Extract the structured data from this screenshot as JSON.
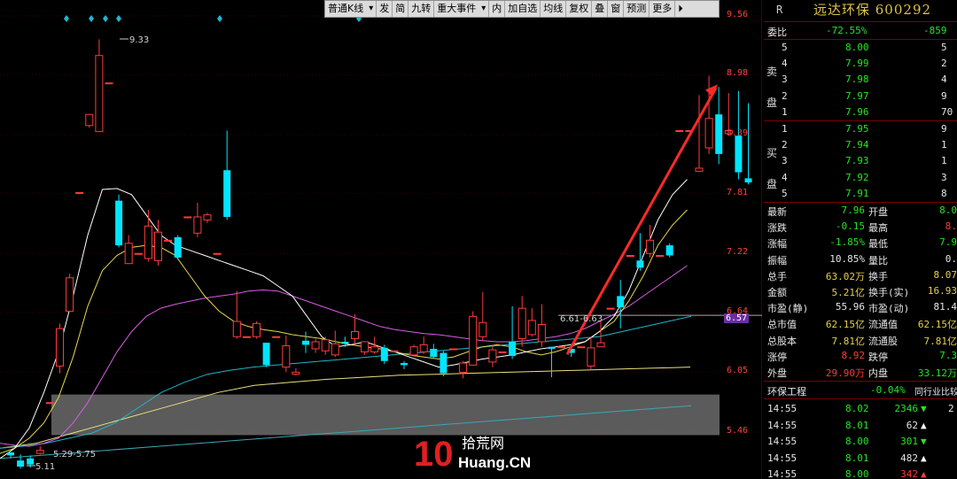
{
  "toolbar": [
    {
      "label": "普通K线",
      "dropdown": true
    },
    {
      "label": "发"
    },
    {
      "label": "简"
    },
    {
      "label": "九转"
    },
    {
      "label": "重大事件",
      "dropdown": true
    },
    {
      "label": "内"
    },
    {
      "label": "加自选"
    },
    {
      "label": "均线"
    },
    {
      "label": "复权"
    },
    {
      "label": "叠"
    },
    {
      "label": "窗"
    },
    {
      "label": "预测"
    },
    {
      "label": "更多"
    },
    {
      "label": "⏵"
    }
  ],
  "stock": {
    "r": "R",
    "name": "远达环保 600292"
  },
  "colors": {
    "up": "#ff3b3b",
    "down": "#00e5ff",
    "ma5": "#ffffff",
    "ma10": "#e6d84a",
    "ma20": "#d95ce6",
    "ma60": "#1fb6c9",
    "ma120": "#e8e080",
    "ma250": "#3aa7b8",
    "box": "#d8d8d8",
    "trend": "#ff2a2a"
  },
  "chart_data": {
    "type": "candlestick",
    "y_ticks": [
      "9.56",
      "8.98",
      "8.39",
      "7.81",
      "7.22",
      "6.64",
      "6.05",
      "5.46"
    ],
    "current_price_label": "6.57",
    "annotations": {
      "high": "9.33",
      "low": "5.11",
      "range": "5.29-5.75",
      "line": "6.61-6.63"
    },
    "event_markers": 4,
    "candles": [
      [
        5.26,
        5.23,
        5.26,
        5.2
      ],
      [
        5.18,
        5.12,
        5.24,
        5.1
      ],
      [
        5.2,
        5.14,
        5.23,
        5.11
      ],
      [
        5.25,
        5.28,
        5.32,
        5.24
      ],
      [
        5.75,
        5.75,
        5.75,
        5.75
      ],
      [
        6.11,
        6.48,
        6.53,
        6.04
      ],
      [
        6.65,
        6.98,
        7.02,
        6.66
      ],
      [
        7.82,
        7.82,
        7.82,
        7.82
      ],
      [
        8.48,
        8.59,
        8.57,
        8.46
      ],
      [
        8.42,
        9.17,
        9.33,
        8.42
      ],
      [
        8.9,
        8.9,
        8.9,
        8.9
      ],
      [
        7.74,
        7.3,
        7.8,
        7.28
      ],
      [
        7.12,
        7.32,
        7.4,
        7.12
      ],
      [
        7.22,
        7.22,
        7.22,
        7.22
      ],
      [
        7.17,
        7.49,
        7.65,
        7.14
      ],
      [
        7.15,
        7.43,
        7.55,
        7.1
      ],
      [
        7.35,
        7.35,
        7.35,
        7.35
      ],
      [
        7.38,
        7.18,
        7.4,
        7.16
      ],
      [
        7.58,
        7.58,
        7.58,
        7.58
      ],
      [
        7.42,
        7.58,
        7.72,
        7.38
      ],
      [
        7.55,
        7.6,
        7.62,
        7.52
      ],
      [
        7.22,
        7.22,
        7.22,
        7.22
      ],
      [
        8.04,
        7.58,
        8.43,
        7.55
      ],
      [
        6.4,
        6.55,
        6.85,
        6.38
      ],
      [
        6.4,
        6.4,
        6.4,
        6.4
      ],
      [
        6.4,
        6.53,
        6.55,
        6.38
      ],
      [
        6.34,
        6.12,
        6.34,
        6.1
      ],
      [
        6.4,
        6.4,
        6.4,
        6.4
      ],
      [
        6.1,
        6.31,
        6.41,
        6.05
      ],
      [
        6.03,
        6.05,
        6.09,
        6.02
      ],
      [
        6.36,
        6.32,
        6.45,
        6.24
      ],
      [
        6.28,
        6.35,
        6.38,
        6.24
      ],
      [
        6.26,
        6.37,
        6.4,
        6.22
      ],
      [
        6.22,
        6.33,
        6.46,
        6.2
      ],
      [
        6.35,
        6.33,
        6.4,
        6.3
      ],
      [
        6.38,
        6.45,
        6.62,
        6.32
      ],
      [
        6.25,
        6.35,
        6.35,
        6.22
      ],
      [
        6.25,
        6.3,
        6.4,
        6.23
      ],
      [
        6.29,
        6.16,
        6.32,
        6.13
      ],
      [
        6.26,
        6.26,
        6.26,
        6.26
      ],
      [
        6.14,
        6.12,
        6.16,
        6.08
      ],
      [
        6.22,
        6.3,
        6.32,
        6.2
      ],
      [
        6.25,
        6.32,
        6.4,
        6.23
      ],
      [
        6.28,
        6.2,
        6.33,
        6.18
      ],
      [
        6.24,
        6.04,
        6.26,
        6.01
      ],
      [
        6.28,
        6.28,
        6.28,
        6.28
      ],
      [
        6.05,
        6.14,
        6.16,
        5.99
      ],
      [
        6.12,
        6.6,
        6.65,
        6.12
      ],
      [
        6.4,
        6.54,
        6.84,
        6.36
      ],
      [
        6.15,
        6.27,
        6.32,
        6.1
      ],
      [
        6.25,
        6.25,
        6.25,
        6.25
      ],
      [
        6.35,
        6.21,
        6.7,
        6.18
      ],
      [
        6.38,
        6.68,
        6.8,
        6.3
      ],
      [
        6.42,
        6.56,
        6.68,
        6.4
      ],
      [
        6.35,
        6.52,
        6.72,
        6.3
      ],
      [
        6.3,
        6.28,
        6.3,
        6.0
      ],
      [
        6.3,
        6.3,
        6.3,
        6.3
      ],
      [
        6.28,
        6.24,
        6.32,
        6.2
      ],
      [
        6.3,
        6.3,
        6.3,
        6.3
      ],
      [
        6.11,
        6.29,
        6.4,
        6.08
      ],
      [
        6.3,
        6.34,
        6.55,
        6.3
      ],
      [
        6.68,
        6.68,
        6.68,
        6.68
      ],
      [
        6.8,
        6.69,
        6.96,
        6.48
      ],
      [
        7.2,
        7.2,
        7.2,
        7.2
      ],
      [
        7.15,
        7.08,
        7.42,
        7.05
      ],
      [
        7.22,
        7.35,
        7.5,
        7.18
      ],
      [
        7.2,
        7.2,
        7.2,
        7.2
      ],
      [
        7.3,
        7.2,
        7.32,
        7.18
      ],
      [
        8.43,
        8.43,
        8.43,
        8.43
      ],
      [
        8.43,
        8.43,
        8.43,
        8.43
      ],
      [
        8.03,
        8.06,
        8.78,
        8.03
      ],
      [
        8.26,
        8.55,
        8.97,
        8.2
      ],
      [
        8.59,
        8.2,
        8.86,
        8.1
      ],
      [
        8.4,
        8.43,
        8.8,
        8.38
      ],
      [
        8.38,
        8.02,
        8.82,
        7.95
      ],
      [
        7.96,
        7.92,
        8.7,
        7.9
      ]
    ],
    "ma_lines": {
      "ma5": [
        5.2,
        5.3,
        5.5,
        5.85,
        6.25,
        6.8,
        7.4,
        7.85,
        7.86,
        7.8,
        7.6,
        7.4,
        7.3,
        7.25,
        7.2,
        7.15,
        7.1,
        7.05,
        7.0,
        6.9,
        6.8,
        6.6,
        6.4,
        6.3,
        6.32,
        6.35,
        6.3,
        6.25,
        6.2,
        6.15,
        6.1,
        6.12,
        6.15,
        6.18,
        6.2,
        6.22,
        6.25,
        6.28,
        6.3,
        6.32,
        6.35,
        6.45,
        6.6,
        6.85,
        7.2,
        7.55,
        7.8,
        7.95
      ],
      "ma10": [
        5.25,
        5.3,
        5.4,
        5.55,
        5.8,
        6.2,
        6.7,
        7.05,
        7.2,
        7.28,
        7.3,
        7.28,
        7.2,
        7.0,
        6.8,
        6.65,
        6.55,
        6.5,
        6.47,
        6.45,
        6.42,
        6.4,
        6.38,
        6.35,
        6.32,
        6.3,
        6.28,
        6.25,
        6.22,
        6.2,
        6.18,
        6.2,
        6.25,
        6.3,
        6.32,
        6.3,
        6.25,
        6.22,
        6.25,
        6.3,
        6.35,
        6.45,
        6.55,
        6.75,
        7.0,
        7.3,
        7.5,
        7.65
      ],
      "ma20": [
        5.35,
        5.33,
        5.32,
        5.35,
        5.4,
        5.55,
        5.75,
        6.0,
        6.25,
        6.45,
        6.6,
        6.68,
        6.72,
        6.75,
        6.78,
        6.8,
        6.82,
        6.85,
        6.86,
        6.85,
        6.8,
        6.75,
        6.7,
        6.65,
        6.6,
        6.55,
        6.5,
        6.47,
        6.45,
        6.43,
        6.42,
        6.4,
        6.38,
        6.36,
        6.35,
        6.35,
        6.36,
        6.38,
        6.4,
        6.43,
        6.48,
        6.55,
        6.62,
        6.7,
        6.8,
        6.9,
        7.0,
        7.1
      ],
      "ma60": [
        5.3,
        5.32,
        5.35,
        5.4,
        5.45,
        5.55,
        5.7,
        5.85,
        5.95,
        6.03,
        6.07,
        6.1,
        6.12,
        6.14,
        6.16,
        6.18,
        6.2,
        6.22,
        6.24,
        6.26,
        6.28,
        6.3,
        6.32,
        6.34,
        6.36,
        6.38,
        6.4,
        6.45,
        6.5,
        6.55,
        6.6
      ],
      "ma120": [
        5.3,
        5.35,
        5.45,
        5.55,
        5.65,
        5.75,
        5.85,
        5.92,
        5.95,
        5.98,
        6.0,
        6.02,
        6.03,
        6.04,
        6.05,
        6.06,
        6.07,
        6.08,
        6.09,
        6.1
      ],
      "ma250": [
        5.2,
        5.24,
        5.28,
        5.32,
        5.36,
        5.4,
        5.44,
        5.48,
        5.52,
        5.56,
        5.6,
        5.64,
        5.68,
        5.72
      ]
    },
    "grey_box": [
      5.43,
      5.83
    ],
    "hline": 6.61,
    "trend": {
      "from": [
        6.7,
        6.4
      ],
      "to": [
        8.92,
        8.55
      ]
    }
  },
  "orderbook": {
    "wb_label": "委比",
    "wb_pct": "-72.55%",
    "wb_val": "-859",
    "sell_label": "卖盘",
    "buy_label": "买盘",
    "sell": [
      {
        "lvl": "5",
        "price": "8.00",
        "vol": "5"
      },
      {
        "lvl": "4",
        "price": "7.99",
        "vol": "2"
      },
      {
        "lvl": "3",
        "price": "7.98",
        "vol": "4"
      },
      {
        "lvl": "2",
        "price": "7.97",
        "vol": "9"
      },
      {
        "lvl": "1",
        "price": "7.96",
        "vol": "70"
      }
    ],
    "buy": [
      {
        "lvl": "1",
        "price": "7.95",
        "vol": "9"
      },
      {
        "lvl": "2",
        "price": "7.94",
        "vol": "1"
      },
      {
        "lvl": "3",
        "price": "7.93",
        "vol": "1"
      },
      {
        "lvl": "4",
        "price": "7.92",
        "vol": "3"
      },
      {
        "lvl": "5",
        "price": "7.91",
        "vol": "8"
      }
    ]
  },
  "stats": [
    {
      "k1": "最新",
      "v1": "7.96",
      "c1": "g",
      "k2": "开盘",
      "v2": "8.0",
      "c2": "g"
    },
    {
      "k1": "涨跌",
      "v1": "-0.15",
      "c1": "g",
      "k2": "最高",
      "v2": "8.",
      "c2": "rd"
    },
    {
      "k1": "涨幅",
      "v1": "-1.85%",
      "c1": "g",
      "k2": "最低",
      "v2": "7.9",
      "c2": "g"
    },
    {
      "k1": "振幅",
      "v1": "10.85%",
      "c1": "w",
      "k2": "量比",
      "v2": "0.",
      "c2": "w"
    },
    {
      "k1": "总手",
      "v1": "63.02万",
      "c1": "y",
      "k2": "换手",
      "v2": "8.07",
      "c2": "y"
    },
    {
      "k1": "金额",
      "v1": "5.21亿",
      "c1": "y",
      "k2": "换手(实)",
      "v2": "16.93",
      "c2": "y"
    },
    {
      "k1": "市盈(静)",
      "v1": "55.96",
      "c1": "w",
      "k2": "市盈(动)",
      "v2": "81.4",
      "c2": "w"
    },
    {
      "k1": "总市值",
      "v1": "62.15亿",
      "c1": "y",
      "k2": "流通值",
      "v2": "62.15亿",
      "c2": "y"
    },
    {
      "k1": "总股本",
      "v1": "7.81亿",
      "c1": "y",
      "k2": "流通股",
      "v2": "7.81亿",
      "c2": "y"
    },
    {
      "k1": "涨停",
      "v1": "8.92",
      "c1": "rd",
      "k2": "跌停",
      "v2": "7.3",
      "c2": "g"
    },
    {
      "k1": "外盘",
      "v1": "29.90万",
      "c1": "rd",
      "k2": "内盘",
      "v2": "33.12万",
      "c2": "g"
    }
  ],
  "sector": {
    "name": "环保工程",
    "pct": "-0.04%",
    "link": "同行业比较"
  },
  "ticks": [
    {
      "t": "14:55",
      "p": "8.02",
      "v": "2346",
      "dir": "down",
      "vc": "g",
      "extra": "2"
    },
    {
      "t": "14:55",
      "p": "8.01",
      "v": "62",
      "dir": "up",
      "vc": "w",
      "extra": ""
    },
    {
      "t": "14:55",
      "p": "8.00",
      "v": "301",
      "dir": "down",
      "vc": "g",
      "extra": ""
    },
    {
      "t": "14:55",
      "p": "8.01",
      "v": "482",
      "dir": "up",
      "vc": "w",
      "extra": ""
    },
    {
      "t": "14:55",
      "p": "8.00",
      "v": "342",
      "dir": "up",
      "vc": "rd",
      "extra": ""
    },
    {
      "t": "14:55",
      "p": "8.00",
      "v": "402",
      "dir": "up",
      "vc": "rd",
      "extra": ""
    }
  ],
  "watermark": {
    "num": "10",
    "cn": "拾荒网",
    "en": "Huang.CN"
  }
}
